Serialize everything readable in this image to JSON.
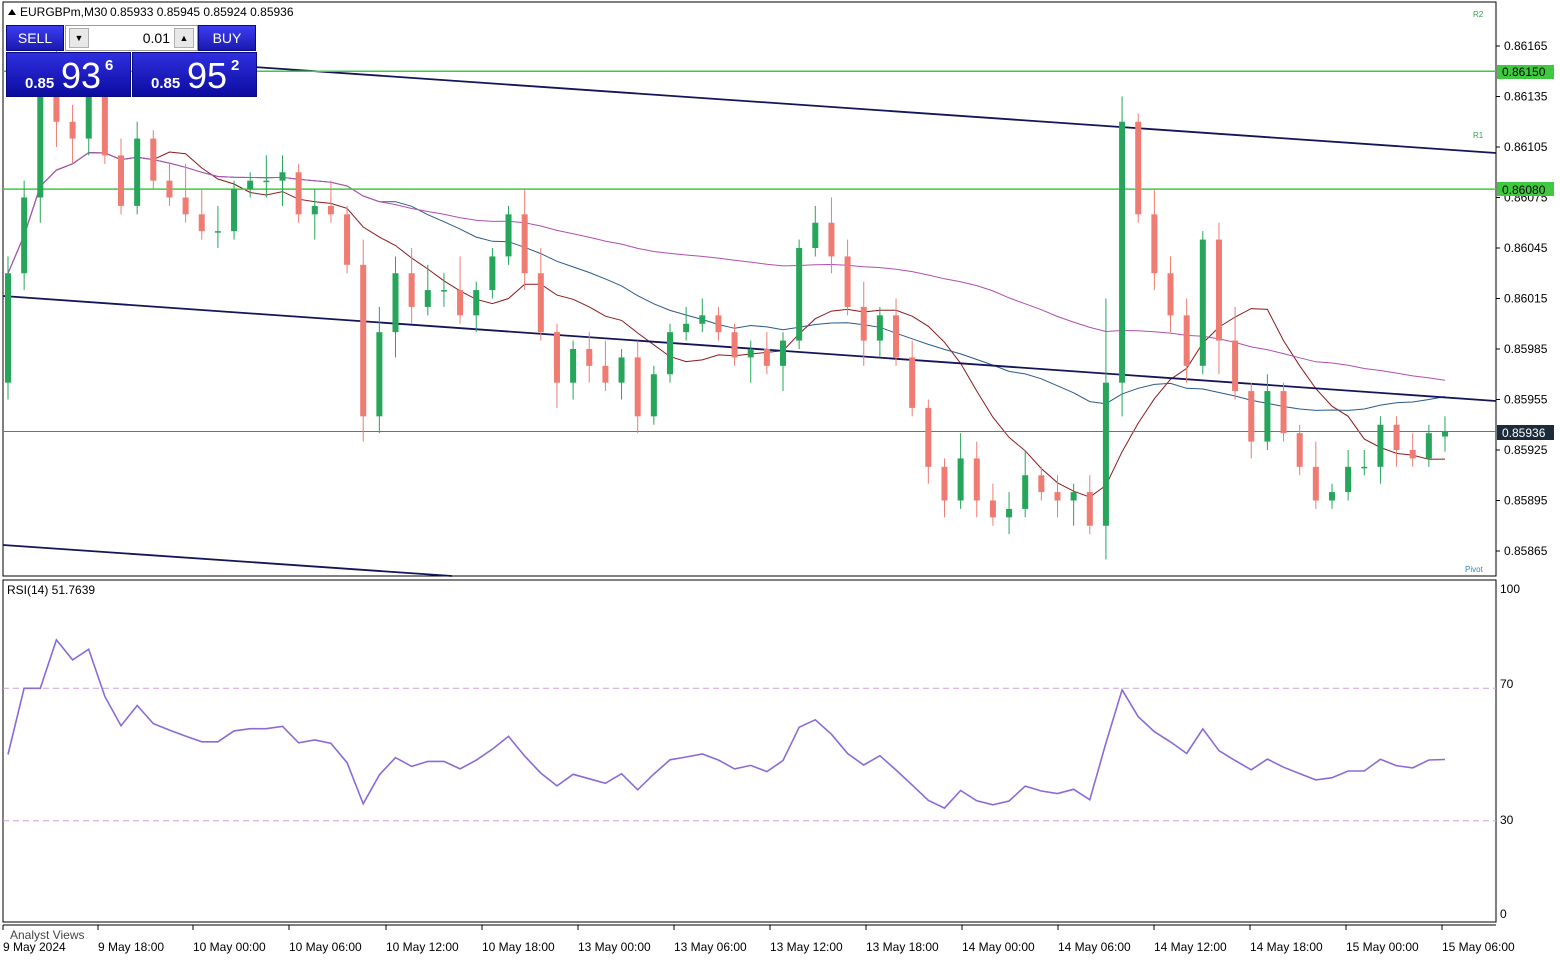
{
  "header": {
    "symbol_timeframe": "EURGBPm,M30",
    "ohlc": "0.85933 0.85945 0.85924 0.85936"
  },
  "trade_panel": {
    "sell_label": "SELL",
    "buy_label": "BUY",
    "lot_value": "0.01",
    "sell_price": {
      "prefix": "0.85",
      "big": "93",
      "sup": "6"
    },
    "buy_price": {
      "prefix": "0.85",
      "big": "95",
      "sup": "2"
    }
  },
  "levels": {
    "r2_label": "R2",
    "r1_label": "R1",
    "pivot_label": "Pivot",
    "r2_value": "0.86150",
    "r1_value": "0.86080",
    "current_price": "0.85936"
  },
  "price_axis": {
    "ticks": [
      "0.86165",
      "0.86135",
      "0.86105",
      "0.86075",
      "0.86045",
      "0.86015",
      "0.85985",
      "0.85955",
      "0.85925",
      "0.85895",
      "0.85865"
    ]
  },
  "rsi": {
    "label": "RSI(14) 51.7639",
    "ticks": [
      "100",
      "70",
      "30",
      "0"
    ],
    "levels": [
      70,
      30
    ]
  },
  "time_axis": {
    "labels": [
      "9 May 2024",
      "9 May 18:00",
      "10 May 00:00",
      "10 May 06:00",
      "10 May 12:00",
      "10 May 18:00",
      "13 May 00:00",
      "13 May 06:00",
      "13 May 12:00",
      "13 May 18:00",
      "14 May 00:00",
      "14 May 06:00",
      "14 May 12:00",
      "14 May 18:00",
      "15 May 00:00",
      "15 May 06:00"
    ]
  },
  "bottom_tab": "Analyst Views",
  "colors": {
    "bull": "#26a65b",
    "bear": "#ef7b73",
    "level_line": "#3ec93e",
    "trend_line": "#14145a",
    "ma_fast": "#8b1a1a",
    "ma_mid": "#2a5a8a",
    "ma_slow": "#b14fb1",
    "rsi_line": "#8a6ad8",
    "current_badge": "#1c2b3a"
  },
  "chart_data": {
    "type": "candlestick",
    "symbol": "EURGBPm",
    "timeframe": "M30",
    "ylim": [
      0.85855,
      0.8618
    ],
    "candles": [
      [
        0.85965,
        0.8604,
        0.85955,
        0.8603
      ],
      [
        0.8603,
        0.86085,
        0.8602,
        0.86075
      ],
      [
        0.86075,
        0.8615,
        0.8606,
        0.8614
      ],
      [
        0.8614,
        0.86165,
        0.86105,
        0.8612
      ],
      [
        0.8612,
        0.8613,
        0.86095,
        0.8611
      ],
      [
        0.8611,
        0.8614,
        0.861,
        0.86135
      ],
      [
        0.86135,
        0.8614,
        0.86095,
        0.861
      ],
      [
        0.861,
        0.8611,
        0.86065,
        0.8607
      ],
      [
        0.8607,
        0.8612,
        0.86065,
        0.8611
      ],
      [
        0.8611,
        0.86115,
        0.8608,
        0.86085
      ],
      [
        0.86085,
        0.86095,
        0.8607,
        0.86075
      ],
      [
        0.86075,
        0.86095,
        0.8606,
        0.86065
      ],
      [
        0.86065,
        0.8608,
        0.8605,
        0.86055
      ],
      [
        0.86055,
        0.8607,
        0.86045,
        0.86055
      ],
      [
        0.86055,
        0.86085,
        0.8605,
        0.8608
      ],
      [
        0.8608,
        0.8609,
        0.86075,
        0.86085
      ],
      [
        0.86085,
        0.861,
        0.86075,
        0.86085
      ],
      [
        0.86085,
        0.861,
        0.8607,
        0.8609
      ],
      [
        0.8609,
        0.86095,
        0.8606,
        0.86065
      ],
      [
        0.86065,
        0.8608,
        0.8605,
        0.8607
      ],
      [
        0.8607,
        0.86085,
        0.8606,
        0.86065
      ],
      [
        0.86065,
        0.8607,
        0.8603,
        0.86035
      ],
      [
        0.86035,
        0.8605,
        0.8593,
        0.85945
      ],
      [
        0.85945,
        0.8601,
        0.85935,
        0.85995
      ],
      [
        0.85995,
        0.8604,
        0.8598,
        0.8603
      ],
      [
        0.8603,
        0.86045,
        0.86,
        0.8601
      ],
      [
        0.8601,
        0.86035,
        0.86005,
        0.8602
      ],
      [
        0.8602,
        0.8603,
        0.8601,
        0.8602
      ],
      [
        0.8602,
        0.8604,
        0.86,
        0.86005
      ],
      [
        0.86005,
        0.86025,
        0.85995,
        0.8602
      ],
      [
        0.8602,
        0.86045,
        0.86015,
        0.8604
      ],
      [
        0.8604,
        0.8607,
        0.86035,
        0.86065
      ],
      [
        0.86065,
        0.8608,
        0.8602,
        0.8603
      ],
      [
        0.8603,
        0.86045,
        0.8599,
        0.85995
      ],
      [
        0.85995,
        0.86,
        0.8595,
        0.85965
      ],
      [
        0.85965,
        0.8599,
        0.85955,
        0.85985
      ],
      [
        0.85985,
        0.85995,
        0.85965,
        0.85975
      ],
      [
        0.85975,
        0.8599,
        0.8596,
        0.85965
      ],
      [
        0.85965,
        0.85985,
        0.85955,
        0.8598
      ],
      [
        0.8598,
        0.8599,
        0.85935,
        0.85945
      ],
      [
        0.85945,
        0.85975,
        0.8594,
        0.8597
      ],
      [
        0.8597,
        0.86,
        0.85965,
        0.85995
      ],
      [
        0.85995,
        0.8601,
        0.8599,
        0.86
      ],
      [
        0.86,
        0.86015,
        0.85995,
        0.86005
      ],
      [
        0.86005,
        0.8601,
        0.8599,
        0.85995
      ],
      [
        0.85995,
        0.86,
        0.85975,
        0.8598
      ],
      [
        0.8598,
        0.8599,
        0.85965,
        0.85985
      ],
      [
        0.85985,
        0.85995,
        0.8597,
        0.85975
      ],
      [
        0.85975,
        0.85995,
        0.8596,
        0.8599
      ],
      [
        0.8599,
        0.8605,
        0.85985,
        0.86045
      ],
      [
        0.86045,
        0.8607,
        0.8604,
        0.8606
      ],
      [
        0.8606,
        0.86075,
        0.8603,
        0.8604
      ],
      [
        0.8604,
        0.8605,
        0.86005,
        0.8601
      ],
      [
        0.8601,
        0.86025,
        0.85975,
        0.8599
      ],
      [
        0.8599,
        0.8601,
        0.8598,
        0.86005
      ],
      [
        0.86005,
        0.86015,
        0.85975,
        0.8598
      ],
      [
        0.8598,
        0.8599,
        0.85945,
        0.8595
      ],
      [
        0.8595,
        0.85955,
        0.85905,
        0.85915
      ],
      [
        0.85915,
        0.8592,
        0.85885,
        0.85895
      ],
      [
        0.85895,
        0.85935,
        0.8589,
        0.8592
      ],
      [
        0.8592,
        0.8593,
        0.85885,
        0.85895
      ],
      [
        0.85895,
        0.85905,
        0.8588,
        0.85885
      ],
      [
        0.85885,
        0.859,
        0.85875,
        0.8589
      ],
      [
        0.8589,
        0.85925,
        0.85885,
        0.8591
      ],
      [
        0.8591,
        0.85915,
        0.85895,
        0.859
      ],
      [
        0.859,
        0.8591,
        0.85885,
        0.85895
      ],
      [
        0.85895,
        0.85905,
        0.8588,
        0.859
      ],
      [
        0.859,
        0.8591,
        0.85875,
        0.8588
      ],
      [
        0.8588,
        0.86015,
        0.8586,
        0.85965
      ],
      [
        0.85965,
        0.86135,
        0.85945,
        0.8612
      ],
      [
        0.8612,
        0.86125,
        0.8606,
        0.86065
      ],
      [
        0.86065,
        0.8608,
        0.8602,
        0.8603
      ],
      [
        0.8603,
        0.8604,
        0.85995,
        0.86005
      ],
      [
        0.86005,
        0.86015,
        0.85965,
        0.85975
      ],
      [
        0.85975,
        0.86055,
        0.8597,
        0.8605
      ],
      [
        0.8605,
        0.8606,
        0.8597,
        0.8599
      ],
      [
        0.8599,
        0.8601,
        0.85955,
        0.8596
      ],
      [
        0.8596,
        0.85965,
        0.8592,
        0.8593
      ],
      [
        0.8593,
        0.8597,
        0.85925,
        0.8596
      ],
      [
        0.8596,
        0.85965,
        0.8593,
        0.85935
      ],
      [
        0.85935,
        0.8594,
        0.8591,
        0.85915
      ],
      [
        0.85915,
        0.8593,
        0.8589,
        0.85895
      ],
      [
        0.85895,
        0.85905,
        0.8589,
        0.859
      ],
      [
        0.859,
        0.85925,
        0.85895,
        0.85915
      ],
      [
        0.85915,
        0.85925,
        0.8591,
        0.85915
      ],
      [
        0.85915,
        0.85945,
        0.85905,
        0.8594
      ],
      [
        0.8594,
        0.85945,
        0.85915,
        0.85925
      ],
      [
        0.85925,
        0.85935,
        0.85915,
        0.8592
      ],
      [
        0.8592,
        0.8594,
        0.85915,
        0.85935
      ],
      [
        0.85933,
        0.85945,
        0.85924,
        0.85936
      ]
    ]
  }
}
